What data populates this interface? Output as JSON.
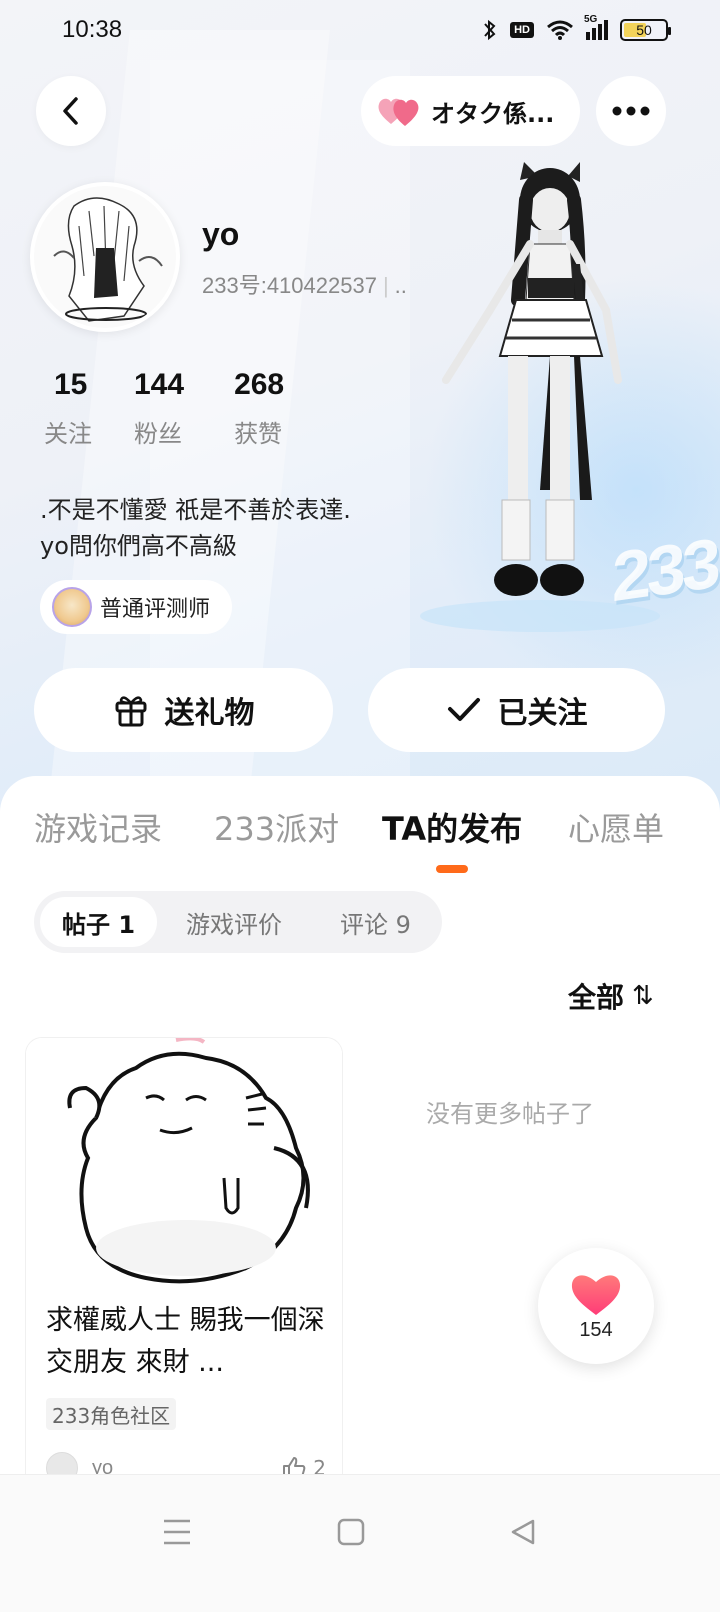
{
  "status_bar": {
    "time": "10:38",
    "hd": "HD",
    "network": "5G",
    "battery": "50"
  },
  "header": {
    "otaku_label": "オタク係..."
  },
  "profile": {
    "username": "yo",
    "user_id": "233号:410422537",
    "id_suffix": "..",
    "stats": [
      {
        "value": "15",
        "label": "关注"
      },
      {
        "value": "144",
        "label": "粉丝"
      },
      {
        "value": "268",
        "label": "获赞"
      }
    ],
    "bio": ".不是不懂愛  祇是不善於表達.\nyo問你們高不高級",
    "badge": "普通评测师",
    "logo_text": "233"
  },
  "actions": {
    "gift": "送礼物",
    "follow": "已关注"
  },
  "tabs": [
    "游戏记录",
    "233派对",
    "TA的发布",
    "心愿单"
  ],
  "active_tab": "TA的发布",
  "subtabs": [
    "帖子 1",
    "游戏评价",
    "评论 9"
  ],
  "sort": {
    "label": "全部",
    "icon": "sort-arrows-icon"
  },
  "post": {
    "title": "求權威人士 賜我一個深交朋友 來財 ...",
    "tag": "233角色社区",
    "author": "yo",
    "likes": "2"
  },
  "no_more_text": "没有更多帖子了",
  "like_float": {
    "count": "154"
  },
  "colors": {
    "accent": "#ff6a1a",
    "heart": "#ff4f6d",
    "pill_heart": "#f06a8a"
  }
}
